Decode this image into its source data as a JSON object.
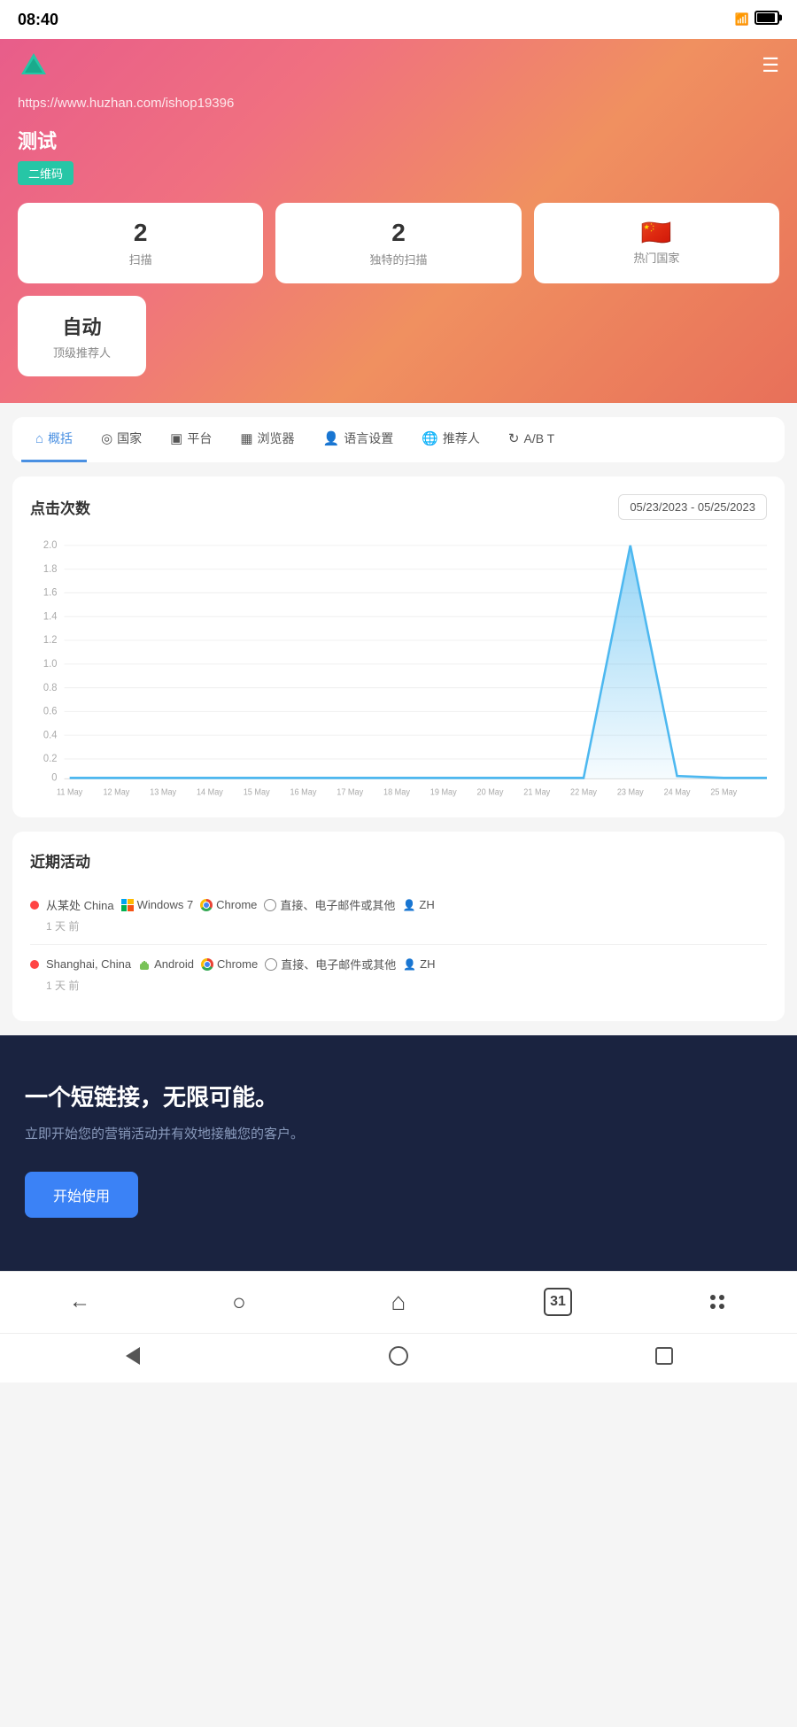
{
  "statusBar": {
    "time": "08:40",
    "signal": "46",
    "icons": [
      "msg1",
      "wechat1",
      "wechat2",
      "search"
    ]
  },
  "header": {
    "url": "https://www.huzhan.com/ishop19396",
    "logoColor": "#26c6a6",
    "menuIcon": "☰"
  },
  "page": {
    "title": "测试",
    "badge": "二维码"
  },
  "stats": [
    {
      "value": "2",
      "label": "扫描"
    },
    {
      "value": "2",
      "label": "独特的扫描"
    },
    {
      "value": "🇨🇳",
      "label": "热门国家",
      "isFlag": true
    }
  ],
  "statsRow2": {
    "value": "自动",
    "label": "顶级推荐人"
  },
  "tabs": [
    {
      "icon": "⌂",
      "label": "概括",
      "active": true
    },
    {
      "icon": "◎",
      "label": "国家",
      "active": false
    },
    {
      "icon": "▣",
      "label": "平台",
      "active": false
    },
    {
      "icon": "▦",
      "label": "浏览器",
      "active": false
    },
    {
      "icon": "👤",
      "label": "语言设置",
      "active": false
    },
    {
      "icon": "🌐",
      "label": "推荐人",
      "active": false
    },
    {
      "icon": "↻",
      "label": "A/B T",
      "active": false
    }
  ],
  "chart": {
    "title": "点击次数",
    "dateRange": "05/23/2023 - 05/25/2023",
    "yAxisLabels": [
      "0",
      "0.2",
      "0.4",
      "0.6",
      "0.8",
      "1.0",
      "1.2",
      "1.4",
      "1.6",
      "1.8",
      "2.0"
    ],
    "xAxisLabels": [
      "11 May",
      "12 May",
      "13 May",
      "14 May",
      "15 May",
      "16 May",
      "17 May",
      "18 May",
      "19 May",
      "20 May",
      "21 May",
      "22 May",
      "23 May",
      "24 May",
      "25 May"
    ],
    "peakDay": "23 May",
    "peakValue": 2.0
  },
  "activity": {
    "title": "近期活动",
    "items": [
      {
        "location": "从某处 China",
        "os": "Windows 7",
        "browser": "Chrome",
        "source": "直接、电子邮件或其他",
        "lang": "ZH",
        "timeAgo": "1 天 前"
      },
      {
        "location": "Shanghai, China",
        "os": "Android",
        "browser": "Chrome",
        "source": "直接、电子邮件或其他",
        "lang": "ZH",
        "timeAgo": "1 天 前"
      }
    ]
  },
  "footer": {
    "title": "一个短链接，无限可能。",
    "subtitle": "立即开始您的营销活动并有效地接触您的客户。",
    "ctaLabel": "开始使用"
  },
  "bottomNav": {
    "back": "←",
    "search": "○",
    "home": "⌂",
    "calendar": "31",
    "menu": "⋮⋮"
  },
  "androidNav": {
    "back": "◁",
    "home": "○",
    "recent": "□"
  }
}
